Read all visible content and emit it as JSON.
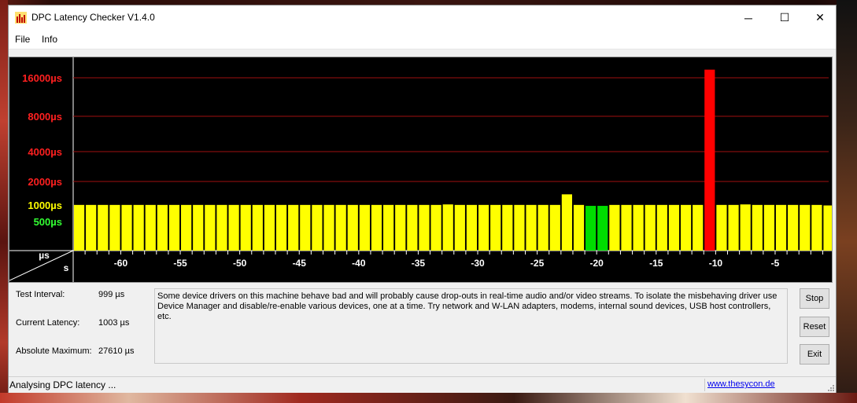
{
  "window": {
    "title": "DPC Latency Checker V1.4.0",
    "icon": "bar-chart-app-icon",
    "controls": {
      "minimize": "─",
      "maximize": "☐",
      "close": "✕"
    }
  },
  "menu": {
    "items": [
      "File",
      "Info"
    ]
  },
  "chart_data": {
    "type": "bar",
    "y_tick_labels": [
      "16000µs",
      "8000µs",
      "4000µs",
      "2000µs",
      "1000µs",
      "500µs"
    ],
    "y_tick_colors": [
      "#ff2020",
      "#ff2020",
      "#ff2020",
      "#ff2020",
      "#ffff00",
      "#33ff33"
    ],
    "y_axis_unit": "µs",
    "x_axis_unit": "s",
    "x_tick_labels": [
      "-60",
      "-55",
      "-50",
      "-45",
      "-40",
      "-35",
      "-30",
      "-25",
      "-20",
      "-15",
      "-10",
      "-5"
    ],
    "x_tick_values": [
      -60,
      -55,
      -50,
      -45,
      -40,
      -35,
      -30,
      -25,
      -20,
      -15,
      -10,
      -5
    ],
    "x_range": [
      -64,
      -0.5
    ],
    "y_scale": "log2",
    "y_range": [
      250,
      24000
    ],
    "bar_x": [
      -63.5,
      -62.5,
      -61.5,
      -60.5,
      -59.5,
      -58.5,
      -57.5,
      -56.5,
      -55.5,
      -54.5,
      -53.5,
      -52.5,
      -51.5,
      -50.5,
      -49.5,
      -48.5,
      -47.5,
      -46.5,
      -45.5,
      -44.5,
      -43.5,
      -42.5,
      -41.5,
      -40.5,
      -39.5,
      -38.5,
      -37.5,
      -36.5,
      -35.5,
      -34.5,
      -33.5,
      -32.5,
      -31.5,
      -30.5,
      -29.5,
      -28.5,
      -27.5,
      -26.5,
      -25.5,
      -24.5,
      -23.5,
      -22.5,
      -21.5,
      -20.5,
      -19.5,
      -18.5,
      -17.5,
      -16.5,
      -15.5,
      -14.5,
      -13.5,
      -12.5,
      -11.5,
      -10.5,
      -9.5,
      -8.5,
      -7.5,
      -6.5,
      -5.5,
      -4.5,
      -3.5,
      -2.5,
      -1.5,
      -0.5
    ],
    "values": [
      1003,
      1003,
      1003,
      1003,
      1003,
      1003,
      1003,
      1003,
      1003,
      1003,
      1003,
      1003,
      1003,
      1003,
      1003,
      1003,
      1003,
      1003,
      1003,
      1003,
      1003,
      1003,
      1003,
      1003,
      1003,
      1003,
      1003,
      1003,
      1003,
      1003,
      1003,
      1015,
      1003,
      1003,
      1003,
      1003,
      1003,
      1003,
      1003,
      1003,
      1003,
      1300,
      1003,
      980,
      980,
      1003,
      1003,
      1003,
      1003,
      1003,
      1003,
      1003,
      1003,
      27610,
      1003,
      1003,
      1015,
      1003,
      1003,
      1003,
      1003,
      1003,
      1003,
      990
    ],
    "bar_colors": [
      "#ffff00",
      "#ffff00",
      "#ffff00",
      "#ffff00",
      "#ffff00",
      "#ffff00",
      "#ffff00",
      "#ffff00",
      "#ffff00",
      "#ffff00",
      "#ffff00",
      "#ffff00",
      "#ffff00",
      "#ffff00",
      "#ffff00",
      "#ffff00",
      "#ffff00",
      "#ffff00",
      "#ffff00",
      "#ffff00",
      "#ffff00",
      "#ffff00",
      "#ffff00",
      "#ffff00",
      "#ffff00",
      "#ffff00",
      "#ffff00",
      "#ffff00",
      "#ffff00",
      "#ffff00",
      "#ffff00",
      "#ffff00",
      "#ffff00",
      "#ffff00",
      "#ffff00",
      "#ffff00",
      "#ffff00",
      "#ffff00",
      "#ffff00",
      "#ffff00",
      "#ffff00",
      "#ffff00",
      "#ffff00",
      "#00dd00",
      "#00dd00",
      "#ffff00",
      "#ffff00",
      "#ffff00",
      "#ffff00",
      "#ffff00",
      "#ffff00",
      "#ffff00",
      "#ffff00",
      "#ff0000",
      "#ffff00",
      "#ffff00",
      "#ffff00",
      "#ffff00",
      "#ffff00",
      "#ffff00",
      "#ffff00",
      "#ffff00",
      "#ffff00",
      "#ffff00"
    ],
    "grid": true,
    "background": "#000000"
  },
  "stats": {
    "test_interval_label": "Test Interval:",
    "test_interval_value": "999 µs",
    "current_latency_label": "Current Latency:",
    "current_latency_value": "1003 µs",
    "absolute_maximum_label": "Absolute Maximum:",
    "absolute_maximum_value": "27610 µs"
  },
  "message": "Some device drivers on this machine behave bad and will probably cause drop-outs in real-time audio and/or video streams. To isolate the misbehaving driver use Device Manager and disable/re-enable various devices, one at a time. Try network and W-LAN adapters, modems, internal sound devices, USB host controllers, etc.",
  "buttons": {
    "stop": "Stop",
    "reset": "Reset",
    "exit": "Exit"
  },
  "status": {
    "text": "Analysing DPC latency ...",
    "link": "www.thesycon.de"
  }
}
